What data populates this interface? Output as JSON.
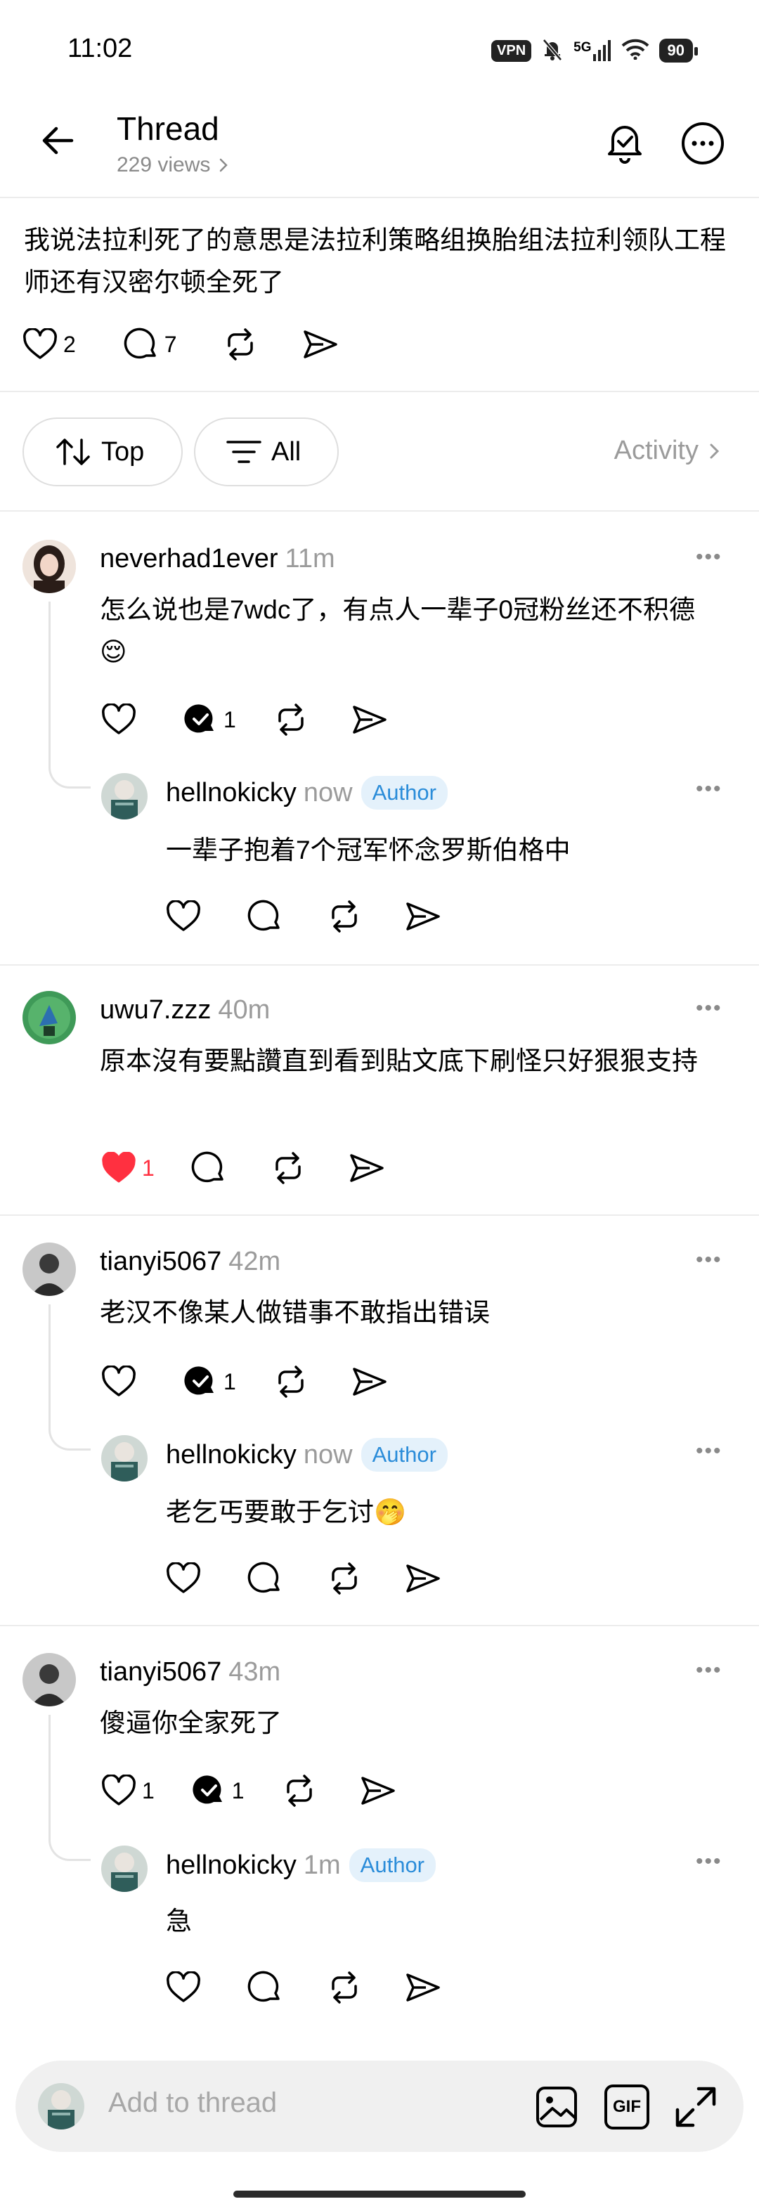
{
  "status_bar": {
    "time": "11:02",
    "vpn": "VPN",
    "network": "5G",
    "battery": "90"
  },
  "header": {
    "title": "Thread",
    "views": "229 views"
  },
  "post": {
    "text": "我说法拉利死了的意思是法拉利策略组换胎组法拉利领队工程师还有汉密尔顿全死了",
    "likes": "2",
    "replies": "7"
  },
  "filters": {
    "sort_label": "Top",
    "filter_label": "All",
    "activity_label": "Activity"
  },
  "comments": [
    {
      "username": "neverhad1ever",
      "time": "11m",
      "text": "怎么说也是7wdc了，有点人一辈子0冠粉丝还不积德",
      "emoji": "😌",
      "replies": "1",
      "reply": {
        "username": "hellnokicky",
        "time": "now",
        "badge": "Author",
        "text": "一辈子抱着7个冠军怀念罗斯伯格中"
      }
    },
    {
      "username": "uwu7.zzz",
      "time": "40m",
      "text": "原本沒有要點讚直到看到貼文底下刷怪只好狠狠支持",
      "likes": "1"
    },
    {
      "username": "tianyi5067",
      "time": "42m",
      "text": "老汉不像某人做错事不敢指出错误",
      "replies": "1",
      "reply": {
        "username": "hellnokicky",
        "time": "now",
        "badge": "Author",
        "text": "老乞丐要敢于乞讨",
        "emoji": "🤭"
      }
    },
    {
      "username": "tianyi5067",
      "time": "43m",
      "text": "傻逼你全家死了",
      "likes": "1",
      "replies": "1",
      "reply": {
        "username": "hellnokicky",
        "time": "1m",
        "badge": "Author",
        "text": "急"
      }
    }
  ],
  "composer": {
    "placeholder": "Add to thread",
    "gif_label": "GIF"
  },
  "colors": {
    "liked_red": "#ff3040",
    "author_blue": "#2a8cd9",
    "author_bg": "#e4f1fb",
    "muted": "#9b9b9b"
  }
}
